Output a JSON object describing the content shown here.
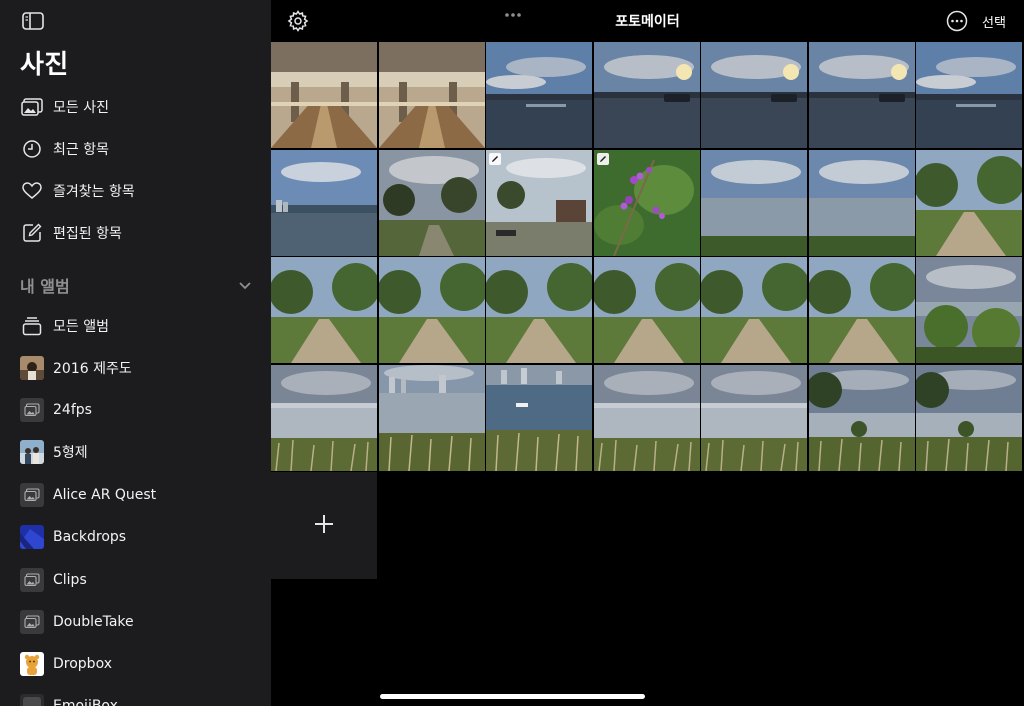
{
  "sidebar": {
    "title": "사진",
    "library_items": [
      {
        "label": "모든 사진",
        "icon": "photo-library-icon"
      },
      {
        "label": "최근 항목",
        "icon": "clock-icon"
      },
      {
        "label": "즐겨찾는 항목",
        "icon": "heart-icon"
      },
      {
        "label": "편집된 항목",
        "icon": "edit-square-icon"
      }
    ],
    "albums_section": {
      "label": "내 앨범",
      "icon": "chevron-down-icon"
    },
    "albums": [
      {
        "label": "모든 앨범",
        "icon": "stacked-albums-icon"
      },
      {
        "label": "2016 제주도",
        "icon": "album-thumbnail"
      },
      {
        "label": "24fps",
        "icon": "album-placeholder-icon"
      },
      {
        "label": "5형제",
        "icon": "album-thumbnail"
      },
      {
        "label": "Alice AR Quest",
        "icon": "album-placeholder-icon"
      },
      {
        "label": "Backdrops",
        "icon": "album-thumbnail"
      },
      {
        "label": "Clips",
        "icon": "album-placeholder-icon"
      },
      {
        "label": "DoubleTake",
        "icon": "album-placeholder-icon"
      },
      {
        "label": "Dropbox",
        "icon": "album-thumbnail"
      },
      {
        "label": "EmojiBox",
        "icon": "album-thumbnail"
      }
    ]
  },
  "topbar": {
    "title": "포토메이터",
    "select_label": "선택",
    "settings_icon": "gear-icon",
    "more_icon": "ellipsis-circle-icon",
    "multitask_icon": "three-dots-icon"
  },
  "grid": {
    "columns": 7,
    "rows": [
      [
        "bridge",
        "bridge",
        "river-sunset",
        "river-boat",
        "river-boat",
        "river-boat",
        "river-sunset"
      ],
      [
        "river-city",
        "park-trees",
        "park-edited",
        "purple-berries-edited",
        "river-wide",
        "river-wide",
        "park-path"
      ],
      [
        "park-path",
        "park-path",
        "park-path",
        "park-path",
        "park-path",
        "park-path",
        "river-bushes"
      ],
      [
        "river-grass",
        "river-city-grass",
        "river-boat-grass",
        "river-grass",
        "river-grass",
        "river-tree-grass",
        "river-tree-grass"
      ]
    ],
    "edited_badge_icon": "edit-pencil-icon",
    "add_icon": "plus-icon"
  },
  "colors": {
    "sidebar_bg": "#1c1c1e",
    "main_bg": "#000000",
    "text": "#ffffff",
    "secondary_text": "#8e8e93"
  }
}
